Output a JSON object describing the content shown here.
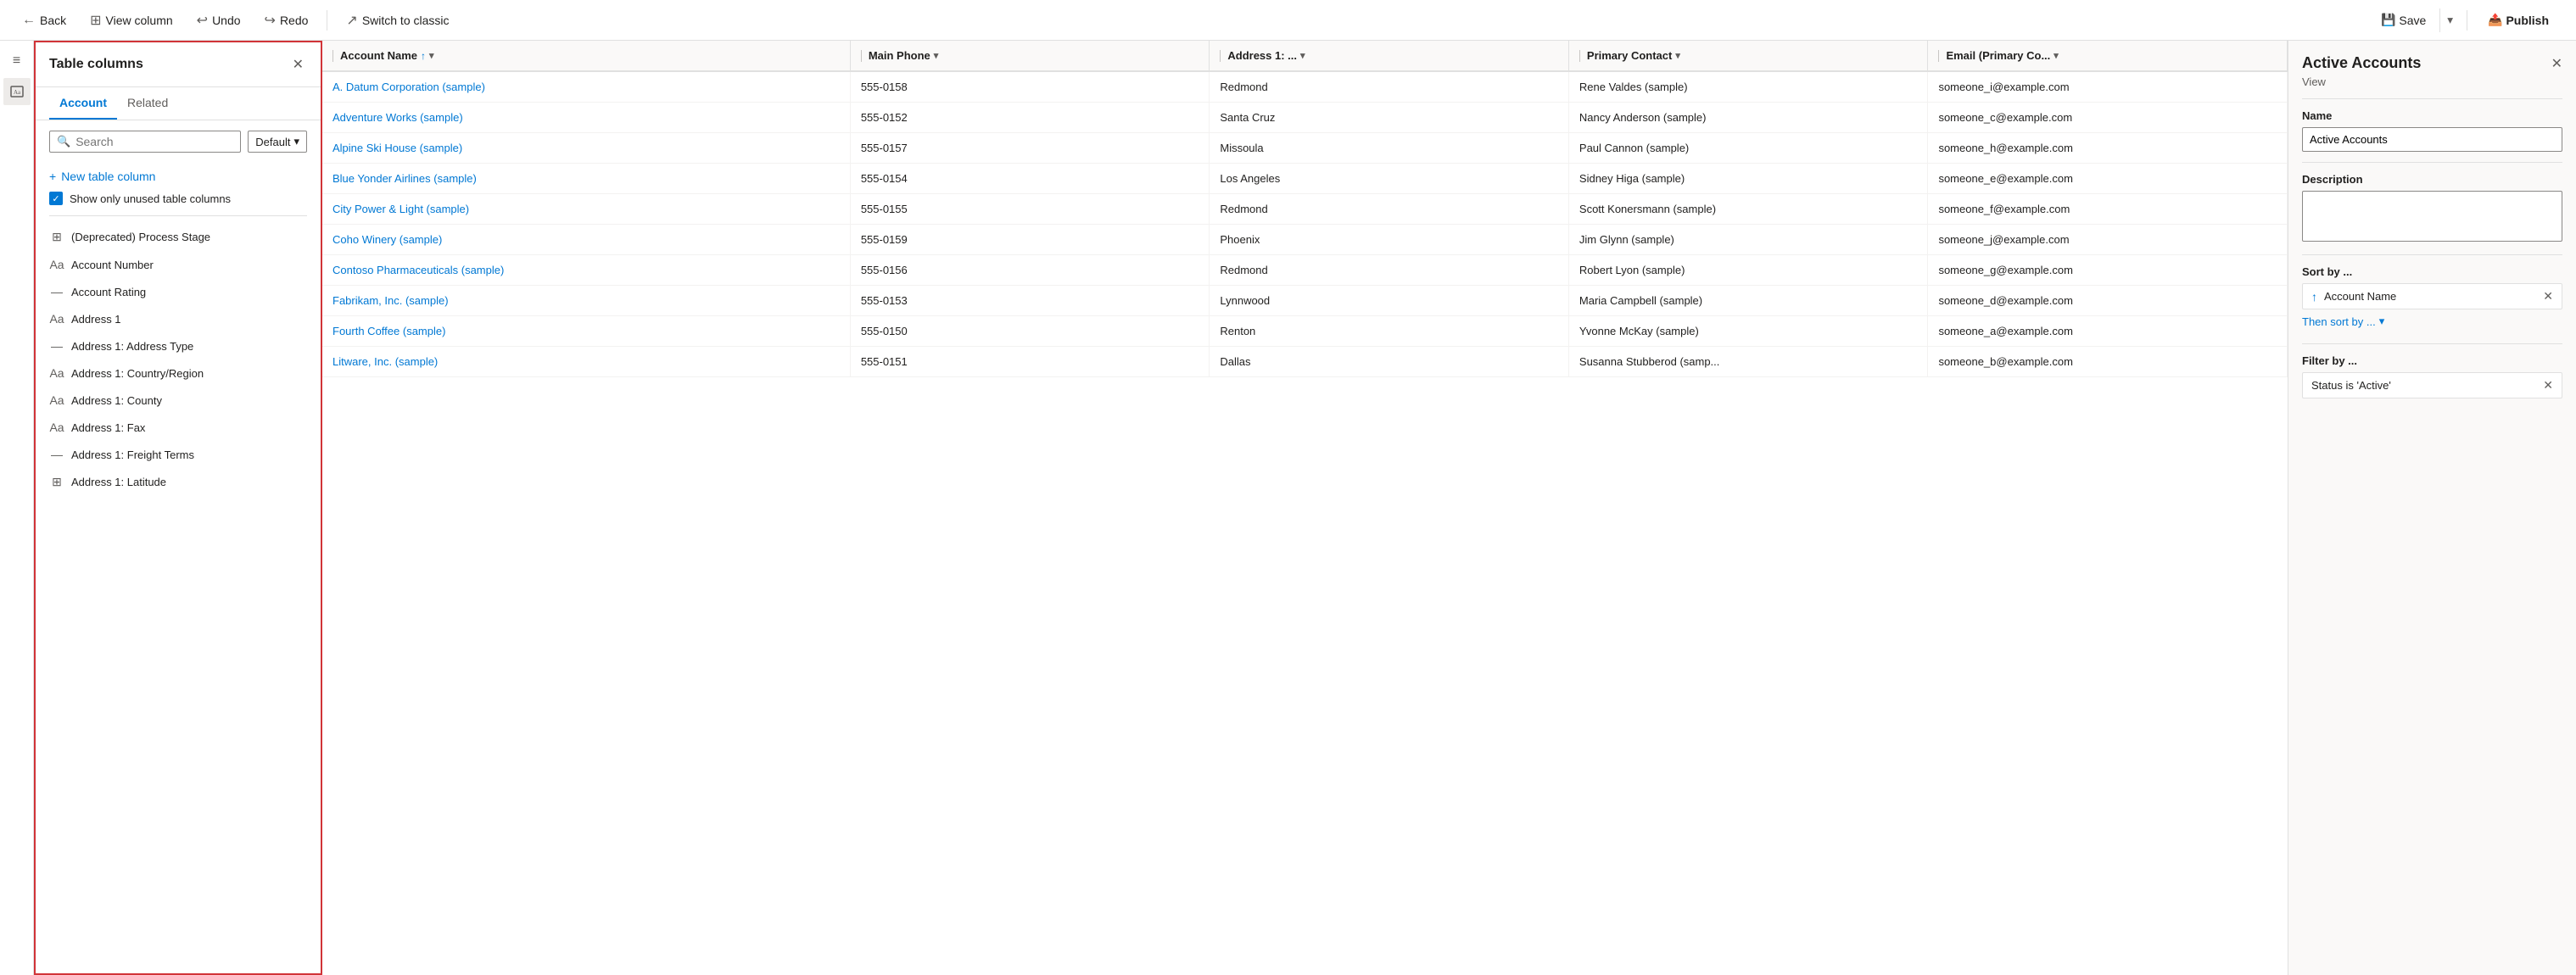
{
  "toolbar": {
    "back_label": "Back",
    "view_column_label": "View column",
    "undo_label": "Undo",
    "redo_label": "Redo",
    "switch_label": "Switch to classic",
    "save_label": "Save",
    "publish_label": "Publish"
  },
  "panel": {
    "title": "Table columns",
    "tabs": [
      "Account",
      "Related"
    ],
    "search_placeholder": "Search",
    "search_default": "Default",
    "new_column_label": "New table column",
    "show_unused_label": "Show only unused table columns",
    "columns": [
      {
        "icon": "grid-icon",
        "name": "(Deprecated) Process Stage"
      },
      {
        "icon": "abc-icon",
        "name": "Account Number"
      },
      {
        "icon": "minus-icon",
        "name": "Account Rating"
      },
      {
        "icon": "abc-icon",
        "name": "Address 1"
      },
      {
        "icon": "minus-icon",
        "name": "Address 1: Address Type"
      },
      {
        "icon": "abc-icon",
        "name": "Address 1: Country/Region"
      },
      {
        "icon": "abc-icon",
        "name": "Address 1: County"
      },
      {
        "icon": "abc-icon",
        "name": "Address 1: Fax"
      },
      {
        "icon": "minus-icon",
        "name": "Address 1: Freight Terms"
      },
      {
        "icon": "grid-icon",
        "name": "Address 1: Latitude"
      }
    ]
  },
  "grid": {
    "columns": [
      {
        "label": "Account Name",
        "sort": true,
        "filter": true
      },
      {
        "label": "Main Phone",
        "filter": true
      },
      {
        "label": "Address 1: ...",
        "filter": true
      },
      {
        "label": "Primary Contact",
        "filter": true
      },
      {
        "label": "Email (Primary Co...",
        "filter": true
      }
    ],
    "rows": [
      {
        "name": "A. Datum Corporation (sample)",
        "phone": "555-0158",
        "address": "Redmond",
        "contact": "Rene Valdes (sample)",
        "email": "someone_i@example.com"
      },
      {
        "name": "Adventure Works (sample)",
        "phone": "555-0152",
        "address": "Santa Cruz",
        "contact": "Nancy Anderson (sample)",
        "email": "someone_c@example.com"
      },
      {
        "name": "Alpine Ski House (sample)",
        "phone": "555-0157",
        "address": "Missoula",
        "contact": "Paul Cannon (sample)",
        "email": "someone_h@example.com"
      },
      {
        "name": "Blue Yonder Airlines (sample)",
        "phone": "555-0154",
        "address": "Los Angeles",
        "contact": "Sidney Higa (sample)",
        "email": "someone_e@example.com"
      },
      {
        "name": "City Power & Light (sample)",
        "phone": "555-0155",
        "address": "Redmond",
        "contact": "Scott Konersmann (sample)",
        "email": "someone_f@example.com"
      },
      {
        "name": "Coho Winery (sample)",
        "phone": "555-0159",
        "address": "Phoenix",
        "contact": "Jim Glynn (sample)",
        "email": "someone_j@example.com"
      },
      {
        "name": "Contoso Pharmaceuticals (sample)",
        "phone": "555-0156",
        "address": "Redmond",
        "contact": "Robert Lyon (sample)",
        "email": "someone_g@example.com"
      },
      {
        "name": "Fabrikam, Inc. (sample)",
        "phone": "555-0153",
        "address": "Lynnwood",
        "contact": "Maria Campbell (sample)",
        "email": "someone_d@example.com"
      },
      {
        "name": "Fourth Coffee (sample)",
        "phone": "555-0150",
        "address": "Renton",
        "contact": "Yvonne McKay (sample)",
        "email": "someone_a@example.com"
      },
      {
        "name": "Litware, Inc. (sample)",
        "phone": "555-0151",
        "address": "Dallas",
        "contact": "Susanna Stubberod (samp...",
        "email": "someone_b@example.com"
      }
    ]
  },
  "properties": {
    "title": "Active Accounts",
    "subtitle": "View",
    "name_label": "Name",
    "name_value": "Active Accounts",
    "description_label": "Description",
    "description_value": "",
    "sort_label": "Sort by ...",
    "sort_field": "Account Name",
    "then_sort_label": "Then sort by ...",
    "filter_label": "Filter by ...",
    "filter_value": "Status is 'Active'"
  },
  "icons": {
    "back": "←",
    "view_column": "⊞",
    "undo": "↩",
    "redo": "↪",
    "switch": "↗",
    "save": "💾",
    "publish": "📤",
    "close": "✕",
    "search": "🔍",
    "chevron_down": "▾",
    "plus": "+",
    "sort_asc": "↑",
    "sort_desc": "↓",
    "filter": "▾",
    "remove": "✕",
    "hamburger": "≡",
    "image": "🖼",
    "grid": "⊞",
    "abc": "Aa",
    "minus": "—"
  }
}
